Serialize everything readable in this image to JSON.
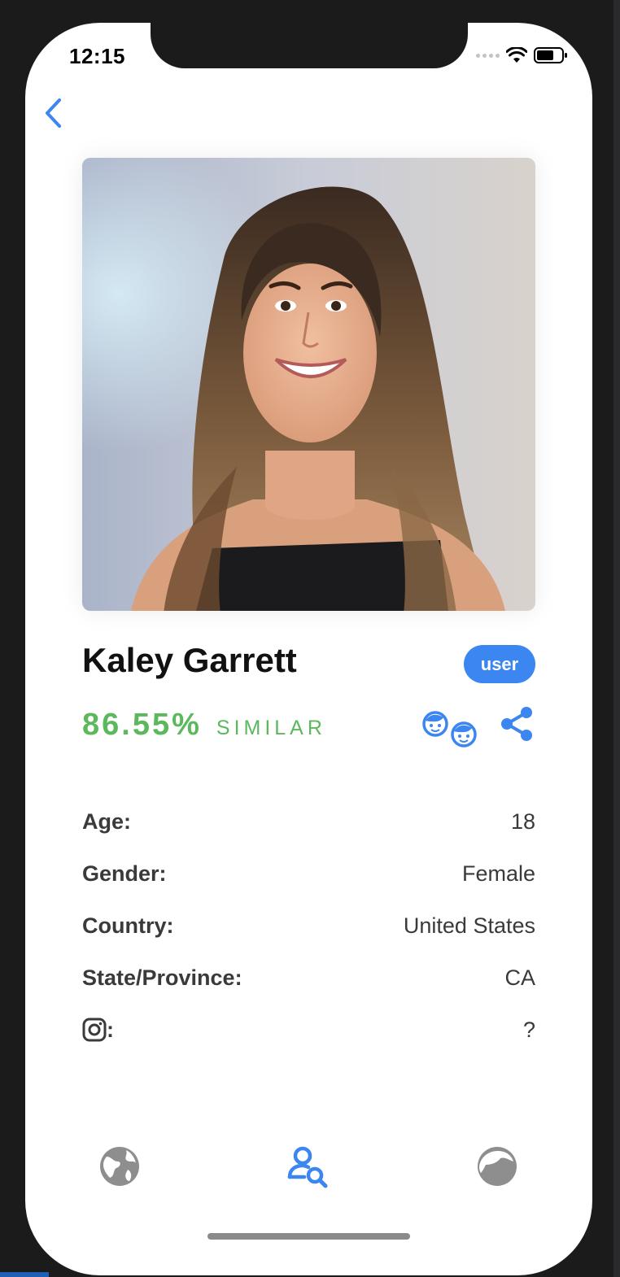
{
  "status_bar": {
    "time": "12:15"
  },
  "profile": {
    "name": "Kaley Garrett",
    "badge": "user",
    "similarity_percent": "86.55%",
    "similar_label": "SIMILAR"
  },
  "details": [
    {
      "label": "Age:",
      "value": "18"
    },
    {
      "label": "Gender:",
      "value": "Female"
    },
    {
      "label": "Country:",
      "value": "United States"
    },
    {
      "label": "State/Province:",
      "value": "CA"
    },
    {
      "label": ":",
      "value": "?"
    }
  ],
  "tabbar": {
    "items": [
      {
        "icon": "globe-icon",
        "active": false
      },
      {
        "icon": "user-search-icon",
        "active": true
      },
      {
        "icon": "face-icon",
        "active": false
      }
    ]
  },
  "colors": {
    "accent": "#3b86f0",
    "similar_green": "#5cb85c",
    "inactive_icon": "#8e8e8e"
  }
}
